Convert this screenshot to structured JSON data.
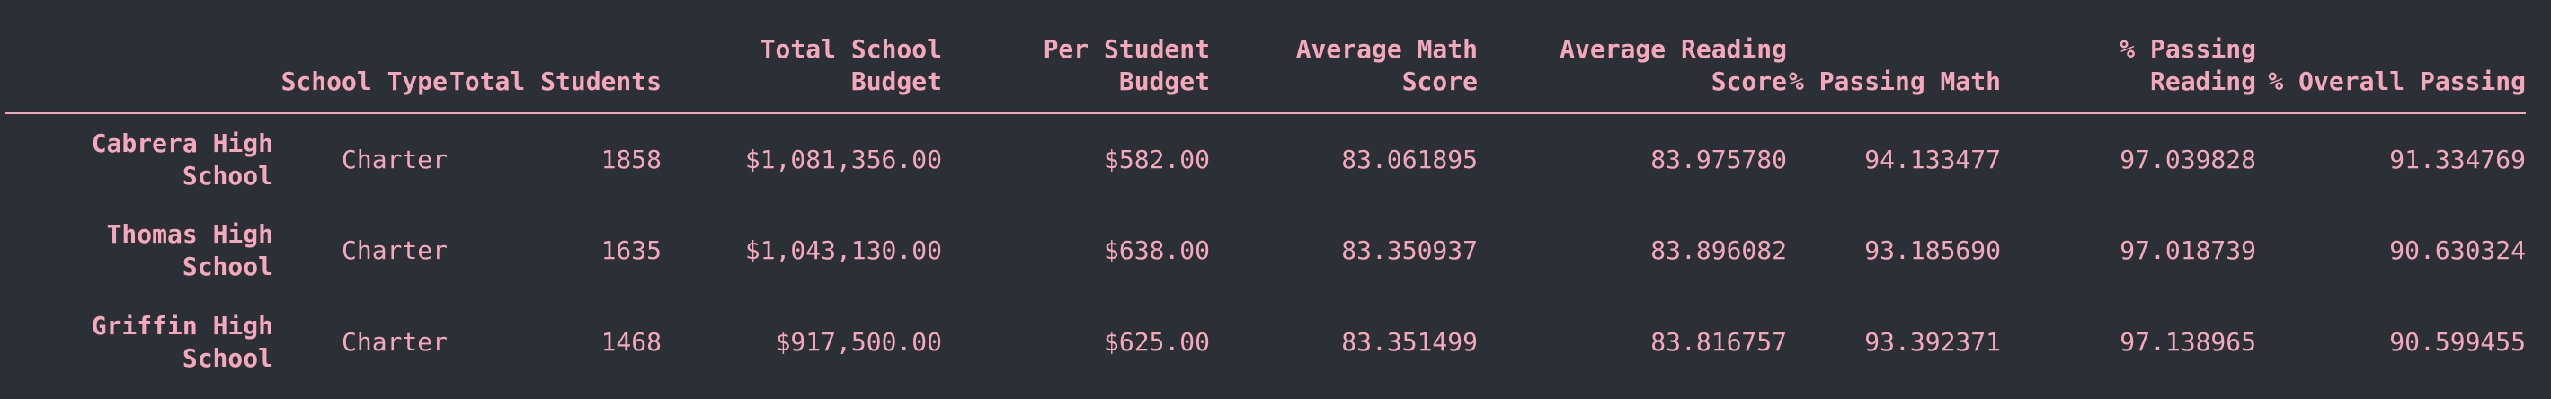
{
  "table": {
    "columns": [
      "",
      "School Type",
      "Total Students",
      "Total School Budget",
      "Per Student Budget",
      "Average Math Score",
      "Average Reading Score",
      "% Passing Math",
      "% Passing Reading",
      "% Overall Passing"
    ],
    "rows": [
      {
        "name": "Cabrera High School",
        "cells": [
          "Charter",
          "1858",
          "$1,081,356.00",
          "$582.00",
          "83.061895",
          "83.975780",
          "94.133477",
          "97.039828",
          "91.334769"
        ]
      },
      {
        "name": "Thomas High School",
        "cells": [
          "Charter",
          "1635",
          "$1,043,130.00",
          "$638.00",
          "83.350937",
          "83.896082",
          "93.185690",
          "97.018739",
          "90.630324"
        ]
      },
      {
        "name": "Griffin High School",
        "cells": [
          "Charter",
          "1468",
          "$917,500.00",
          "$625.00",
          "83.351499",
          "83.816757",
          "93.392371",
          "97.138965",
          "90.599455"
        ]
      }
    ]
  },
  "colors": {
    "background": "#2b3036",
    "text": "#f5a8bc"
  }
}
